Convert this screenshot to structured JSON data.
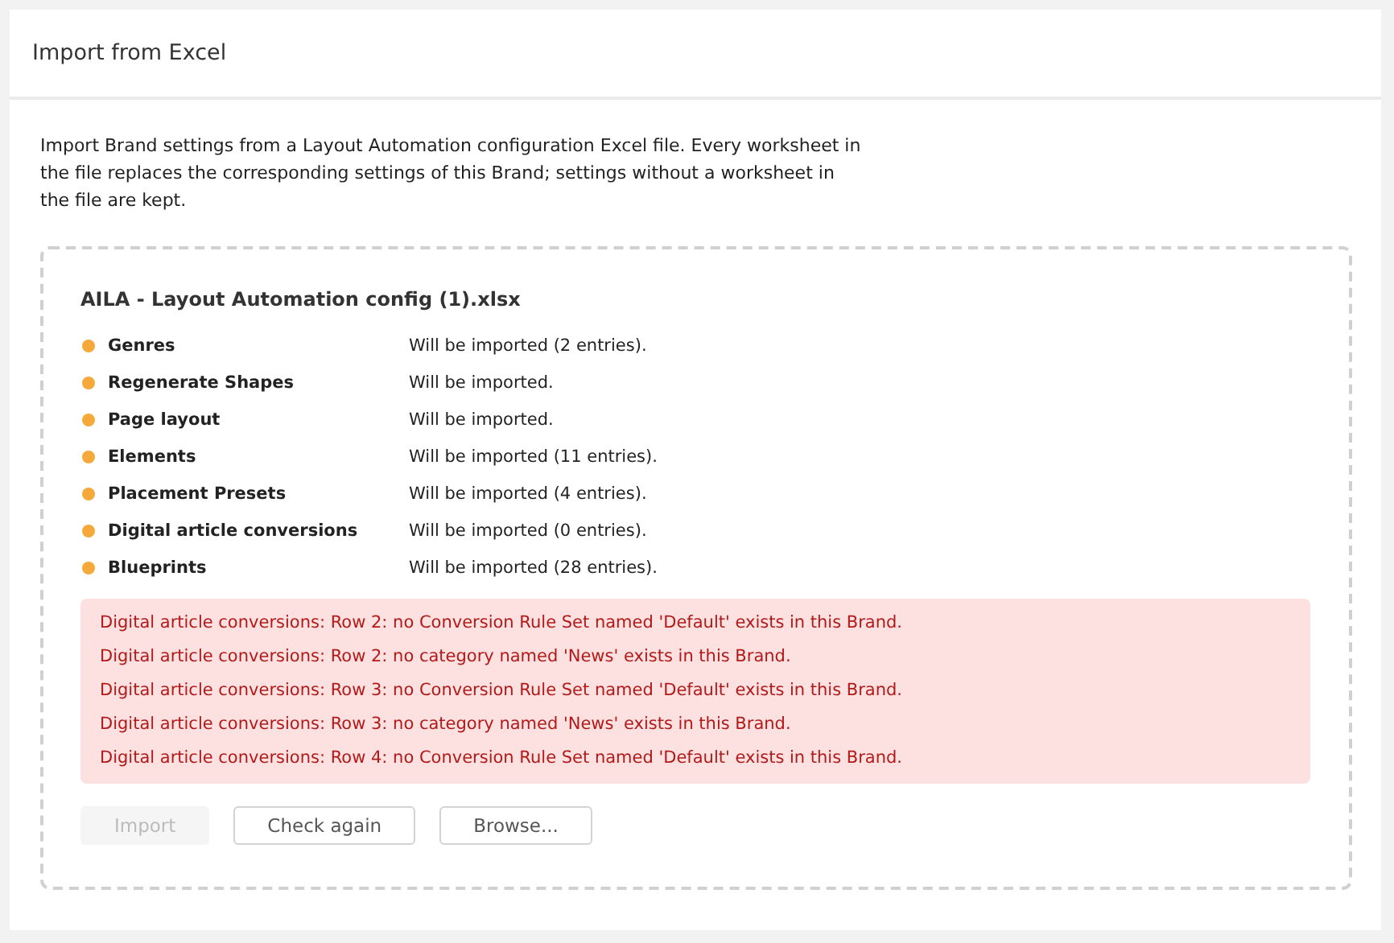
{
  "dialog": {
    "title": "Import from Excel",
    "description": "Import Brand settings from a Layout Automation configuration Excel file. Every worksheet in the file replaces the corresponding settings of this Brand; settings without a worksheet in the file are kept."
  },
  "file": {
    "name": "AILA - Layout Automation config (1).xlsx",
    "sheets": [
      {
        "name": "Genres",
        "status": "Will be imported (2 entries)."
      },
      {
        "name": "Regenerate Shapes",
        "status": "Will be imported."
      },
      {
        "name": "Page layout",
        "status": "Will be imported."
      },
      {
        "name": "Elements",
        "status": "Will be imported (11 entries)."
      },
      {
        "name": "Placement Presets",
        "status": "Will be imported (4 entries)."
      },
      {
        "name": "Digital article conversions",
        "status": "Will be imported (0 entries)."
      },
      {
        "name": "Blueprints",
        "status": "Will be imported (28 entries)."
      }
    ],
    "errors": [
      "Digital article conversions: Row 2: no Conversion Rule Set named 'Default' exists in this Brand.",
      "Digital article conversions: Row 2: no category named 'News' exists in this Brand.",
      "Digital article conversions: Row 3: no Conversion Rule Set named 'Default' exists in this Brand.",
      "Digital article conversions: Row 3: no category named 'News' exists in this Brand.",
      "Digital article conversions: Row 4: no Conversion Rule Set named 'Default' exists in this Brand."
    ]
  },
  "buttons": [
    {
      "label": "Import",
      "disabled": true
    },
    {
      "label": "Check again",
      "disabled": false
    },
    {
      "label": "Browse...",
      "disabled": false
    }
  ]
}
